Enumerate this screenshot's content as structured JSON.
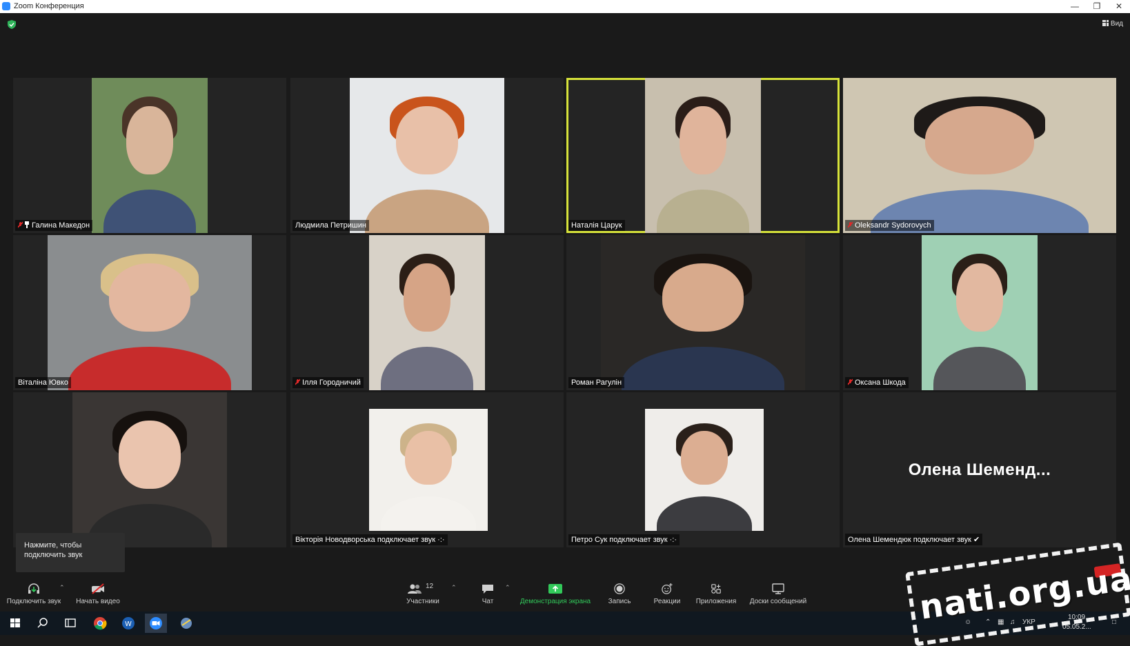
{
  "window": {
    "title": "Zoom Конференция",
    "minimize_icon": "minimize-icon",
    "restore_icon": "restore-icon",
    "close_icon": "close-icon"
  },
  "header": {
    "view_label": "Вид"
  },
  "participants_grid": [
    {
      "name": "Галина Македон",
      "muted": true,
      "pinned": true,
      "photo": {
        "bg": "#6f8c5a",
        "skin": "#d9b59a",
        "hair": "#4a3428",
        "clothes": "#3f5276"
      }
    },
    {
      "name": "Людмила Петришин",
      "muted": false,
      "photo": {
        "bg": "#e6e8ea",
        "skin": "#e8c0a8",
        "hair": "#c9541c",
        "clothes": "#c9a482"
      }
    },
    {
      "name": "Наталія Царук",
      "muted": false,
      "active": true,
      "photo": {
        "bg": "#c8bfae",
        "skin": "#e0b49b",
        "hair": "#2a1d18",
        "clothes": "#b8b090"
      }
    },
    {
      "name": "Oleksandr Sydorovych",
      "muted": true,
      "photo": {
        "bg": "#cfc6b2",
        "skin": "#d6a88d",
        "hair": "#1e1a18",
        "clothes": "#6d85b0"
      }
    },
    {
      "name": "Віталіна Ювко",
      "muted": false,
      "photo": {
        "bg": "#8a8d8f",
        "skin": "#e3b79f",
        "hair": "#d9c08a",
        "clothes": "#c72c2c"
      }
    },
    {
      "name": "Ілля Городничий",
      "muted": true,
      "photo": {
        "bg": "#d8d2c8",
        "skin": "#d6a486",
        "hair": "#2b1e16",
        "clothes": "#6e6f80"
      }
    },
    {
      "name": "Роман Рагулін",
      "muted": false,
      "photo": {
        "bg": "#2a2826",
        "skin": "#d8aa8c",
        "hair": "#1a1410",
        "clothes": "#2a3650"
      }
    },
    {
      "name": "Оксана Шкода",
      "muted": true,
      "photo": {
        "bg": "#9fd0b4",
        "skin": "#e2b8a0",
        "hair": "#2b1f18",
        "clothes": "#55565a"
      }
    },
    {
      "name": "",
      "muted": false,
      "photo": {
        "bg": "#3a3634",
        "skin": "#eac4ae",
        "hair": "#16110e",
        "clothes": "#2a2a2a"
      }
    },
    {
      "name": "Вікторія Новодворська подключает звук",
      "muted": false,
      "status": "connecting",
      "photo": {
        "bg": "#f2f0ec",
        "skin": "#e9c0a6",
        "hair": "#cdb38a",
        "clothes": "#f4f2ee"
      }
    },
    {
      "name": "Петро Сук подключает звук",
      "muted": false,
      "status": "connecting",
      "photo": {
        "bg": "#efedea",
        "skin": "#dcae92",
        "hair": "#2a201a",
        "clothes": "#3c3c40"
      }
    },
    {
      "name": "Олена Шемендюк подключает звук",
      "muted": false,
      "status": "connected",
      "display_name": "Олена  Шеменд..."
    }
  ],
  "tooltip": {
    "line1": "Нажмите, чтобы",
    "line2": "подключить звук"
  },
  "toolbar": {
    "audio": "Подключить звук",
    "video": "Начать видео",
    "participants": "Участники",
    "participants_count": "12",
    "chat": "Чат",
    "share": "Демонстрация экрана",
    "record": "Запись",
    "reactions": "Реакции",
    "apps": "Приложения",
    "whiteboards": "Доски сообщений"
  },
  "taskbar": {
    "lang": "УКР",
    "time": "10:09",
    "date": "05.05.2..."
  },
  "watermark": {
    "text": "nati.org.ua"
  },
  "colors": {
    "active_border": "#d7e33a",
    "share_green": "#32c95a",
    "mute_red": "#e02828"
  }
}
